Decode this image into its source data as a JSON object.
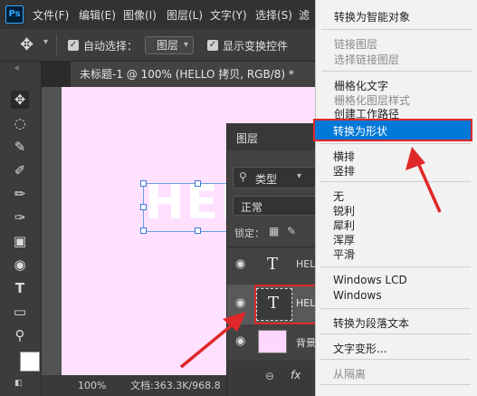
{
  "menubar": {
    "logo": "Ps",
    "items": [
      "文件(F)",
      "编辑(E)",
      "图像(I)",
      "图层(L)",
      "文字(Y)",
      "选择(S)",
      "滤"
    ]
  },
  "options": {
    "auto_select_label": "自动选择：",
    "auto_select_value": "图层",
    "show_transform_label": "显示变换控件"
  },
  "document": {
    "tab_title": "未标题-1 @ 100% (HELLO 拷贝, RGB/8) *",
    "canvas_text": "HEL"
  },
  "status": {
    "zoom": "100%",
    "doc_info": "文档:363.3K/968.8"
  },
  "layers_panel": {
    "title": "图层",
    "filter_label": "类型",
    "blend_mode": "正常",
    "lock_label": "锁定：",
    "layers": [
      {
        "name": "HEL",
        "type": "text"
      },
      {
        "name": "HEL",
        "type": "text"
      },
      {
        "name": "背景",
        "type": "background"
      }
    ],
    "fx_label": "fx"
  },
  "context_menu": {
    "items": [
      {
        "label": "转换为智能对象",
        "disabled": false
      },
      {
        "label": "链接图层",
        "disabled": true
      },
      {
        "label": "选择链接图层",
        "disabled": true
      },
      {
        "label": "栅格化文字",
        "disabled": false
      },
      {
        "label": "栅格化图层样式",
        "disabled": true
      },
      {
        "label": "创建工作路径",
        "disabled": false
      },
      {
        "label": "转换为形状",
        "disabled": false,
        "highlighted": true
      },
      {
        "label": "横排",
        "disabled": false
      },
      {
        "label": "竖排",
        "disabled": false
      },
      {
        "label": "无",
        "disabled": false
      },
      {
        "label": "锐利",
        "disabled": false
      },
      {
        "label": "犀利",
        "disabled": false
      },
      {
        "label": "浑厚",
        "disabled": false
      },
      {
        "label": "平滑",
        "disabled": false
      },
      {
        "label": "Windows LCD",
        "disabled": false
      },
      {
        "label": "Windows",
        "disabled": false
      },
      {
        "label": "转换为段落文本",
        "disabled": false
      },
      {
        "label": "文字变形...",
        "disabled": false
      },
      {
        "label": "从隔离",
        "disabled": true
      }
    ]
  },
  "colors": {
    "accent_highlight": "#0078d7",
    "annotation_red": "#e02828",
    "canvas_bg": "#ffe0ff",
    "foreground_swatch": "#ffffff",
    "background_swatch": "#ffd6ff"
  }
}
